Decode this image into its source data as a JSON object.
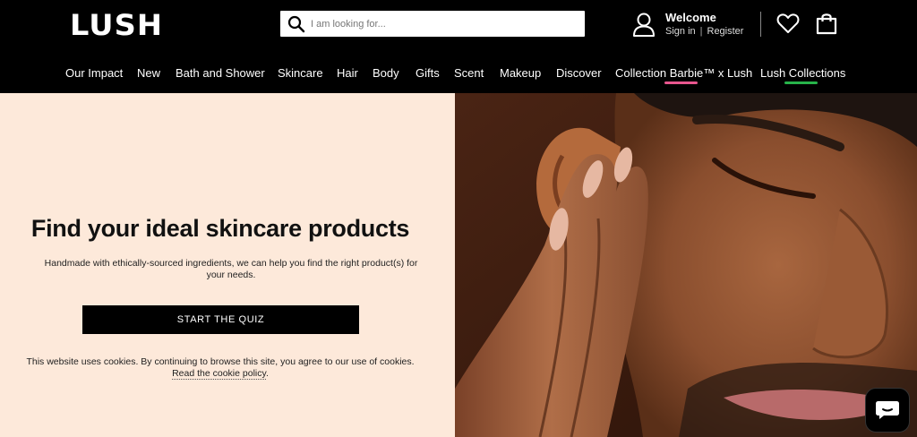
{
  "header": {
    "logo": "LUSH",
    "search_placeholder": "I am looking for...",
    "account": {
      "welcome": "Welcome",
      "sign_in": "Sign in",
      "separator": "|",
      "register": "Register"
    }
  },
  "nav": {
    "items": [
      {
        "label": "Our Impact"
      },
      {
        "label": "New"
      },
      {
        "label": "Bath and Shower"
      },
      {
        "label": "Skincare"
      },
      {
        "label": "Hair"
      },
      {
        "label": "Body"
      },
      {
        "label": "Gifts"
      },
      {
        "label": "Scent"
      },
      {
        "label": "Makeup"
      },
      {
        "label": "Discover"
      },
      {
        "label": "Collection Barbie™ x Lush",
        "accent": "#e8568e"
      },
      {
        "label": "Lush Collections",
        "accent": "#27b34a"
      }
    ]
  },
  "hero": {
    "title": "Find your ideal skincare products",
    "subtitle_line1": "Handmade with ethically-sourced ingredients, we can help you find the right product(s) for",
    "subtitle_line2": "your needs.",
    "cta": "START THE QUIZ",
    "image_icon": "man-touching-face-photo"
  },
  "cookie": {
    "text": "This website uses cookies. By continuing to browse this site, you agree to our use of cookies.",
    "link": "Read the cookie policy",
    "end": "."
  },
  "chat": {
    "icon": "chat-bubble-icon"
  },
  "colors": {
    "header_bg": "#000000",
    "hero_left_bg": "#fde9da",
    "barbie_accent": "#e8568e",
    "collections_accent": "#27b34a"
  }
}
